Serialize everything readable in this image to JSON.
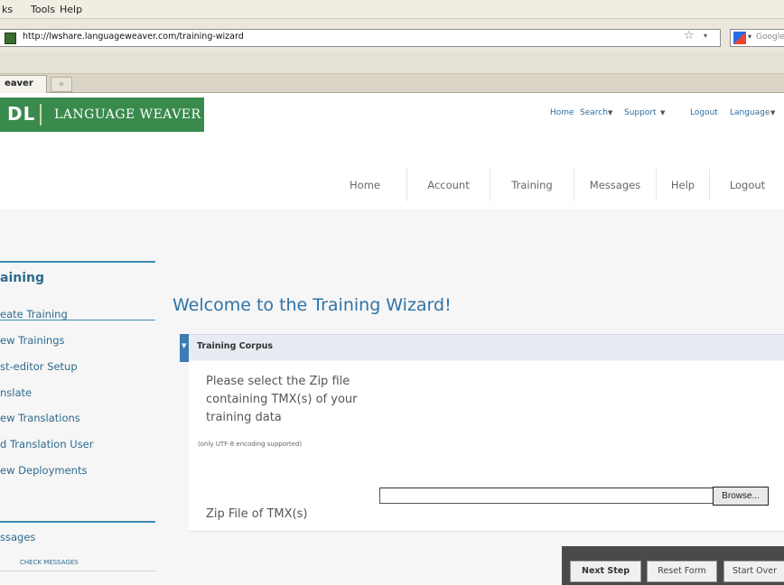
{
  "browser": {
    "menu": [
      "ks",
      "Tools",
      "Help"
    ],
    "url": "http://lwshare.languageweaver.com/training-wizard",
    "search_placeholder": "Google",
    "tab_label": "eaver",
    "new_tab": "+"
  },
  "site": {
    "logo_sdl": "DL",
    "logo_name": "LANGUAGE WEAVER",
    "top_links": [
      "Home",
      "Search",
      "Support",
      "Logout",
      "Language"
    ],
    "main_nav": [
      "Home",
      "Account",
      "Training",
      "Messages",
      "Help",
      "Logout"
    ]
  },
  "sidebar": {
    "heading": "aining",
    "items": [
      "eate Training",
      "ew Trainings",
      "st-editor Setup",
      "nslate",
      "ew Translations",
      "d Translation User",
      "ew Deployments"
    ],
    "messages_heading": "ssages",
    "check_messages": "CHECK MESSAGES"
  },
  "main": {
    "welcome": "Welcome to the Training Wizard!",
    "section_title": "Training Corpus",
    "instructions": "Please select the Zip file containing TMX(s) of your training data",
    "encoding_note": "(only UTF-8 encoding supported)",
    "zip_label": "Zip File of TMX(s)",
    "file_value": "",
    "browse_label": "Browse..."
  },
  "actions": {
    "next": "Next Step",
    "reset": "Reset Form",
    "start_over": "Start Over"
  }
}
